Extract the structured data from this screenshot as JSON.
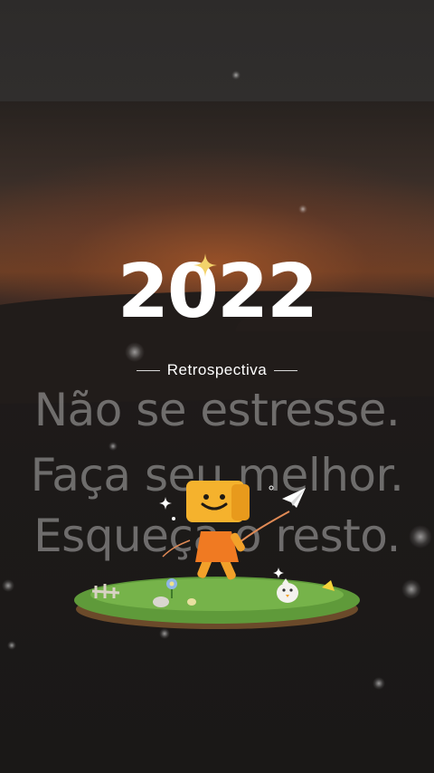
{
  "story": {
    "year": "2022",
    "subtitle": "Retrospectiva",
    "quote_lines": [
      "Não se estresse.",
      "Faça seu melhor.",
      "Esqueça o resto."
    ]
  },
  "icons": {
    "sparkle": "sparkle-icon",
    "paper_plane": "paper-plane-icon",
    "mascot": "smiley-box-mascot"
  },
  "colors": {
    "sunset_orange": "#6b3f25",
    "text_white": "#ffffff",
    "sparkle_gold": "#f3d36b",
    "mascot_orange": "#f2a12a"
  }
}
